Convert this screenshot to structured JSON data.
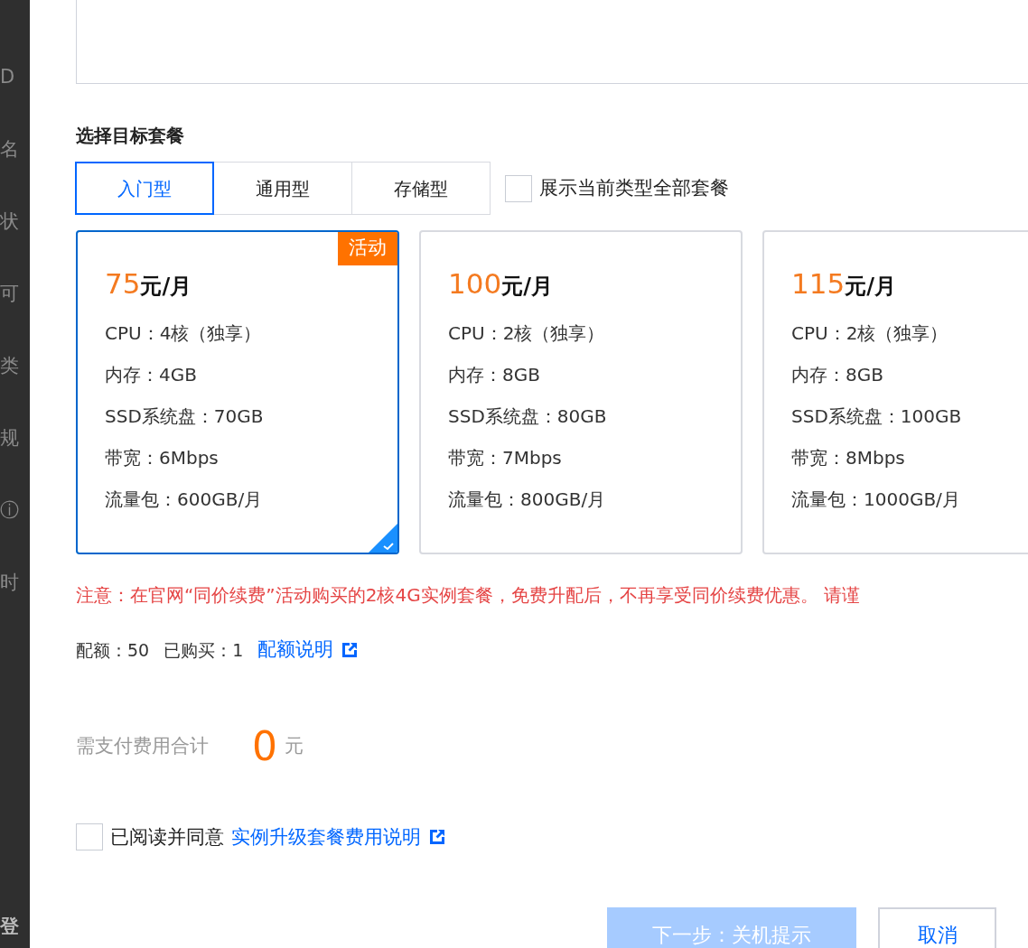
{
  "background_labels": [
    {
      "text": "D",
      "kind": "label"
    },
    {
      "text": "名",
      "kind": "label"
    },
    {
      "text": "状",
      "kind": "label"
    },
    {
      "text": "可",
      "kind": "label"
    },
    {
      "text": "类",
      "kind": "label"
    },
    {
      "text": "规",
      "kind": "label"
    },
    {
      "text": "ⓘ",
      "kind": "label"
    },
    {
      "text": "时",
      "kind": "label"
    },
    {
      "text": "登",
      "kind": "heading"
    }
  ],
  "section_title": "选择目标套餐",
  "tabs": [
    {
      "label": "入门型",
      "selected": true
    },
    {
      "label": "通用型",
      "selected": false
    },
    {
      "label": "存储型",
      "selected": false
    }
  ],
  "show_all": {
    "label": "展示当前类型全部套餐",
    "checked": false
  },
  "plans": [
    {
      "price": "75",
      "unit": "元/月",
      "badge": "活动",
      "selected": true,
      "specs": [
        "CPU：4核（独享）",
        "内存：4GB",
        "SSD系统盘：70GB",
        "带宽：6Mbps",
        "流量包：600GB/月"
      ]
    },
    {
      "price": "100",
      "unit": "元/月",
      "selected": false,
      "specs": [
        "CPU：2核（独享）",
        "内存：8GB",
        "SSD系统盘：80GB",
        "带宽：7Mbps",
        "流量包：800GB/月"
      ]
    },
    {
      "price": "115",
      "unit": "元/月",
      "selected": false,
      "specs": [
        "CPU：2核（独享）",
        "内存：8GB",
        "SSD系统盘：100GB",
        "带宽：8Mbps",
        "流量包：1000GB/月"
      ]
    }
  ],
  "notice": "注意：在官网“同价续费”活动购买的2核4G实例套餐，免费升配后，不再享受同价续费优惠。 请谨",
  "quota": {
    "quota_label": "配额：50",
    "bought_label": "已购买：1",
    "link": "配额说明"
  },
  "total": {
    "label": "需支付费用合计",
    "amount": "0",
    "unit": "元"
  },
  "agree": {
    "checked": false,
    "label": "已阅读并同意",
    "link": "实例升级套餐费用说明"
  },
  "buttons": [
    {
      "label": "下一步：关机提示",
      "kind": "primary",
      "disabled": true
    },
    {
      "label": "取消",
      "kind": "secondary",
      "disabled": false
    }
  ]
}
